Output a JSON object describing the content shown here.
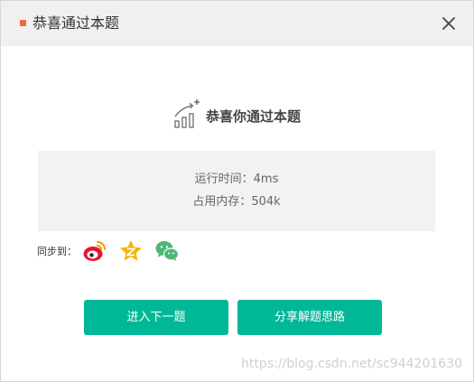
{
  "dialog": {
    "title": "恭喜通过本题"
  },
  "result": {
    "message": "恭喜你通过本题",
    "runtime_text": "运行时间：4ms",
    "memory_text": "占用内存：504k"
  },
  "share": {
    "label": "同步到：",
    "icons": [
      "weibo-icon",
      "qzone-icon",
      "wechat-icon"
    ]
  },
  "buttons": {
    "next_label": "进入下一题",
    "share_label": "分享解题思路"
  },
  "watermark": "https://blog.csdn.net/sc944201630",
  "colors": {
    "accent": "#00b897",
    "title_marker": "#ee6a47",
    "titlebar_bg": "#f0f0f0",
    "stats_bg": "#f2f2f2",
    "weibo": "#e6162d",
    "qzone": "#f7b500",
    "wechat": "#50b674"
  }
}
